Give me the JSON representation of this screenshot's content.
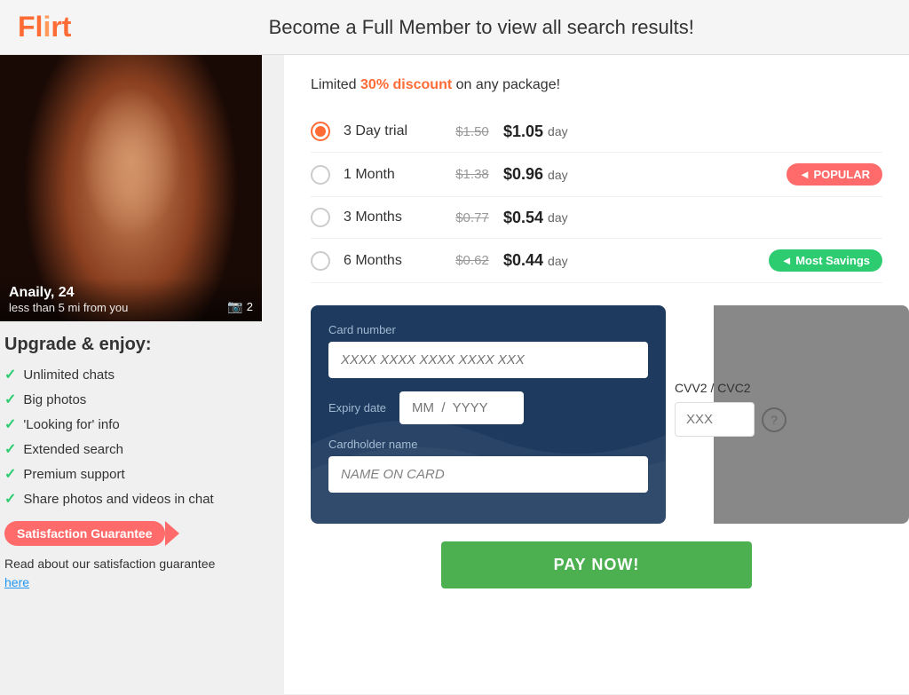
{
  "header": {
    "logo": "Flirt",
    "title": "Become a Full Member to view all search results!"
  },
  "profile": {
    "name": "Anaily",
    "age": "24",
    "distance": "less than 5 mi from you",
    "photo_count": "2"
  },
  "upgrade": {
    "title": "Upgrade & enjoy:",
    "features": [
      "Unlimited chats",
      "Big photos",
      "'Looking for' info",
      "Extended search",
      "Premium support",
      "Share photos and videos in chat"
    ]
  },
  "satisfaction": {
    "button_label": "Satisfaction Guarantee",
    "description": "Read about our satisfaction guarantee",
    "link_label": "here"
  },
  "discount": {
    "text_before": "Limited ",
    "highlight": "30% discount",
    "text_after": " on any package!"
  },
  "plans": [
    {
      "id": "3day",
      "name": "3 Day trial",
      "old_price": "$1.50",
      "new_price": "$1.05",
      "per_day": "day",
      "selected": true,
      "badge": null
    },
    {
      "id": "1month",
      "name": "1 Month",
      "old_price": "$1.38",
      "new_price": "$0.96",
      "per_day": "day",
      "selected": false,
      "badge": "popular",
      "badge_label": "POPULAR"
    },
    {
      "id": "3months",
      "name": "3 Months",
      "old_price": "$0.77",
      "new_price": "$0.54",
      "per_day": "day",
      "selected": false,
      "badge": null
    },
    {
      "id": "6months",
      "name": "6 Months",
      "old_price": "$0.62",
      "new_price": "$0.44",
      "per_day": "day",
      "selected": false,
      "badge": "savings",
      "badge_label": "Most Savings"
    }
  ],
  "payment": {
    "card_number_label": "Card number",
    "card_number_placeholder": "XXXX XXXX XXXX XXXX XXX",
    "expiry_label": "Expiry date",
    "expiry_placeholder": "MM  /  YYYY",
    "cardholder_label": "Cardholder name",
    "cardholder_placeholder": "NAME ON CARD",
    "cvv_label": "CVV2 / CVC2",
    "cvv_placeholder": "XXX",
    "pay_button": "PAY NOW!"
  }
}
